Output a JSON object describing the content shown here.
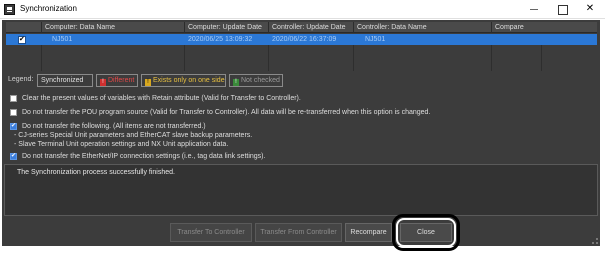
{
  "window": {
    "title": "Synchronization",
    "app_icon": "synchronization-app-icon",
    "controls": {
      "minimize": "—",
      "maximize": "",
      "close": "✕"
    }
  },
  "table": {
    "columns": [
      "Computer: Data Name",
      "Computer: Update Date",
      "Controller: Update Date",
      "Controller: Data Name",
      "Compare"
    ],
    "rows": [
      {
        "checked": true,
        "computer_data_name": "NJ501",
        "computer_update_date": "2020/06/25 13:09:32",
        "controller_update_date": "2020/06/22 16:37:09",
        "controller_data_name": "NJ501",
        "compare": ""
      }
    ]
  },
  "legend": {
    "label": "Legend:",
    "synchronized": "Synchronized",
    "different": "Different",
    "one_side": "Exists only on one side",
    "not_checked": "Not checked"
  },
  "options": {
    "opt1": {
      "checked": false,
      "text": "Clear the present values of variables with Retain attribute (Valid for Transfer to Controller)."
    },
    "opt2": {
      "checked": false,
      "text": "Do not transfer the POU program source (Valid for Transfer to Controller). All data will be re-transferred when this option is changed."
    },
    "opt3": {
      "checked": true,
      "text": "Do not transfer the following. (All items are not transferred.)",
      "sub1": "- CJ-series Special Unit parameters and EtherCAT slave backup parameters.",
      "sub2": "- Slave Terminal Unit operation settings and NX Unit application data."
    },
    "opt4": {
      "checked": true,
      "text": "Do not transfer the EtherNet/IP connection settings (i.e., tag data link settings)."
    }
  },
  "message": "The Synchronization process successfully finished.",
  "buttons": {
    "transfer_to": "Transfer To Controller",
    "transfer_from": "Transfer From Controller",
    "recompare": "Recompare",
    "close": "Close"
  },
  "colors": {
    "panel_bg": "#3c3c3c",
    "selected_row": "#2b78d6",
    "different": "#e04848",
    "one_side": "#e8c040",
    "not_checked": "#9a9a9a",
    "highlight_ring": "#000000"
  }
}
